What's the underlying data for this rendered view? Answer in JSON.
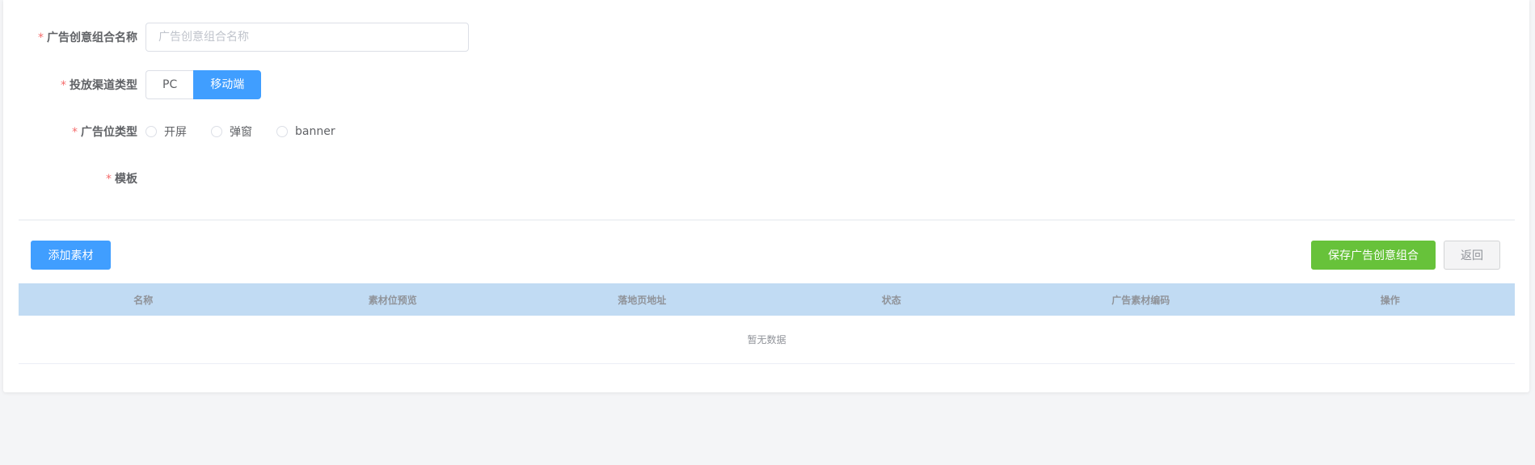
{
  "form": {
    "name_label": "广告创意组合名称",
    "name_placeholder": "广告创意组合名称",
    "name_value": "",
    "channel_label": "投放渠道类型",
    "channel_options": [
      "PC",
      "移动端"
    ],
    "channel_selected": "移动端",
    "position_label": "广告位类型",
    "position_options": [
      "开屏",
      "弹窗",
      "banner"
    ],
    "template_label": "模板",
    "required_mark": "*"
  },
  "toolbar": {
    "add_material_label": "添加素材",
    "save_label": "保存广告创意组合",
    "back_label": "返回"
  },
  "table": {
    "columns": [
      "名称",
      "素材位预览",
      "落地页地址",
      "状态",
      "广告素材编码",
      "操作"
    ],
    "empty_text": "暂无数据"
  },
  "colors": {
    "primary": "#409eff",
    "success": "#67c23a",
    "required": "#f56c6c",
    "table_header_bg": "#c1dbf3"
  }
}
